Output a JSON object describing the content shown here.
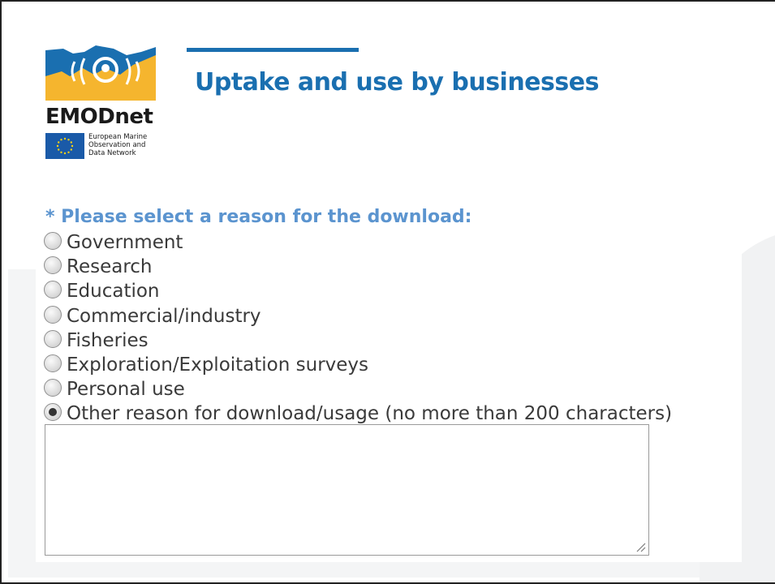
{
  "header": {
    "title": "Uptake and use by businesses"
  },
  "logo": {
    "wordmark": "EMODnet",
    "tagline": "European Marine\nObservation and\nData Network",
    "colors": {
      "blue": "#1a6fb0",
      "yellow": "#f5b52e",
      "eu_blue": "#1a5aa8",
      "eu_star": "#f7d117"
    }
  },
  "form": {
    "prompt": "* Please select a reason for the download:",
    "options": [
      {
        "label": "Government",
        "checked": false
      },
      {
        "label": "Research",
        "checked": false
      },
      {
        "label": "Education",
        "checked": false
      },
      {
        "label": "Commercial/industry",
        "checked": false
      },
      {
        "label": "Fisheries",
        "checked": false
      },
      {
        "label": "Exploration/Exploitation surveys",
        "checked": false
      },
      {
        "label": "Personal use",
        "checked": false
      },
      {
        "label": "Other reason for download/usage (no more than 200 characters)",
        "checked": true
      }
    ],
    "other_reason_value": ""
  },
  "colors": {
    "title": "#1a6fb0",
    "prompt": "#5b94cf",
    "option_text": "#3a3a3a"
  }
}
